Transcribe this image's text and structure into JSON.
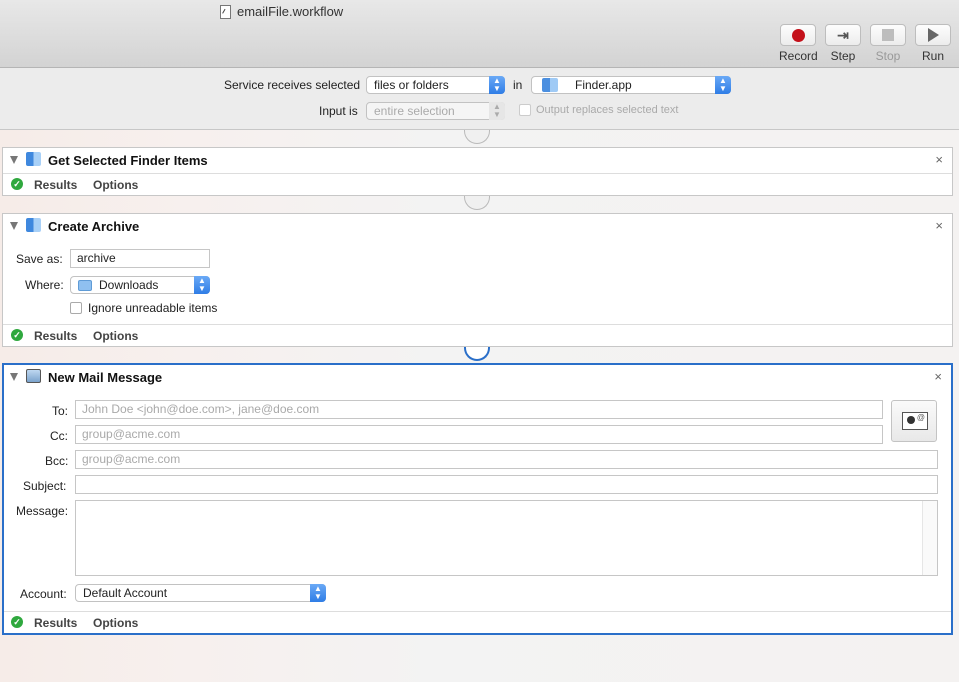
{
  "window": {
    "title": "emailFile.workflow"
  },
  "toolbar": {
    "record_label": "Record",
    "step_label": "Step",
    "stop_label": "Stop",
    "run_label": "Run"
  },
  "service": {
    "receives_label": "Service receives selected",
    "receives_value": "files or folders",
    "in_label": "in",
    "app_value": "Finder.app",
    "input_label": "Input is",
    "input_value": "entire selection",
    "output_replaces_label": "Output replaces selected text"
  },
  "actions": [
    {
      "title": "Get Selected Finder Items",
      "results_label": "Results",
      "options_label": "Options"
    },
    {
      "title": "Create Archive",
      "save_as_label": "Save as:",
      "save_as_value": "archive",
      "where_label": "Where:",
      "where_value": "Downloads",
      "ignore_label": "Ignore unreadable items",
      "results_label": "Results",
      "options_label": "Options"
    },
    {
      "title": "New Mail Message",
      "to_label": "To:",
      "to_placeholder": "John Doe <john@doe.com>, jane@doe.com",
      "cc_label": "Cc:",
      "cc_placeholder": "group@acme.com",
      "bcc_label": "Bcc:",
      "bcc_placeholder": "group@acme.com",
      "subject_label": "Subject:",
      "message_label": "Message:",
      "account_label": "Account:",
      "account_value": "Default Account",
      "results_label": "Results",
      "options_label": "Options"
    }
  ],
  "icons": {
    "close": "×",
    "check": "✓",
    "popup_arrows": "▲▼"
  },
  "colors": {
    "accent": "#2a6fc9",
    "record": "#c4101a",
    "success": "#2fa83e"
  }
}
